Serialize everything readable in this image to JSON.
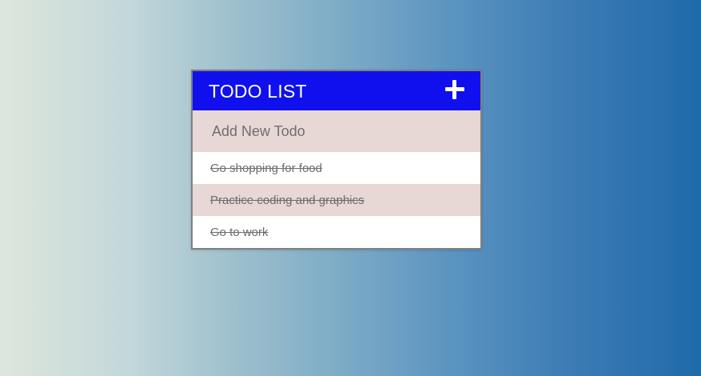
{
  "todo": {
    "title": "TODO LIST",
    "add_icon": "plus-icon",
    "new_todo_placeholder": "Add New Todo",
    "items": [
      {
        "label": "Go shopping for food",
        "completed": true
      },
      {
        "label": "Practice coding and graphics",
        "completed": true
      },
      {
        "label": "Go to work",
        "completed": true
      }
    ]
  },
  "colors": {
    "header": "#1010ee",
    "alt_row": "#e7d7d5",
    "border": "#7f7f7f",
    "gradient_start": "#dde6dc",
    "gradient_end": "#1f6aaa"
  }
}
